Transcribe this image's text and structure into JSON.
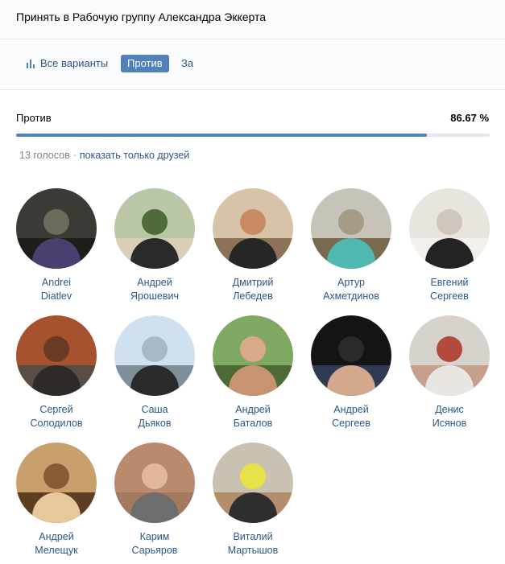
{
  "header": {
    "title": "Принять в Рабочую группу Александра Эккерта"
  },
  "tabs": {
    "all_label": "Все варианты",
    "against_label": "Против",
    "for_label": "За"
  },
  "result": {
    "label": "Против",
    "percent_text": "86.67 %",
    "percent_value": 86.67,
    "votes_text": "13 голосов",
    "separator": "·",
    "friends_link": "показать только друзей"
  },
  "colors": {
    "accent": "#5181b8",
    "link": "#2a5885",
    "muted": "#828282"
  },
  "voters": [
    {
      "first": "Andrei",
      "last": "Diatlev",
      "tones": [
        "#3b3a35",
        "#6e6a5c",
        "#4a3f6e",
        "#1f1d1a"
      ]
    },
    {
      "first": "Андрей",
      "last": "Ярошевич",
      "tones": [
        "#b9c7a6",
        "#4f6a3b",
        "#2a2a2a",
        "#d9cdb8"
      ]
    },
    {
      "first": "Дмитрий",
      "last": "Лебедев",
      "tones": [
        "#d7c4a8",
        "#c98a63",
        "#262626",
        "#8c7358"
      ]
    },
    {
      "first": "Артур",
      "last": "Ахметдинов",
      "tones": [
        "#c8c3b8",
        "#a69b86",
        "#4fb8b0",
        "#7a6a4d"
      ]
    },
    {
      "first": "Евгений",
      "last": "Сергеев",
      "tones": [
        "#e8e4de",
        "#cfc7bd",
        "#232323",
        "#f4f1ec"
      ]
    },
    {
      "first": "Сергей",
      "last": "Солодилов",
      "tones": [
        "#a6522e",
        "#6b3a22",
        "#2d2a27",
        "#5a4d44"
      ]
    },
    {
      "first": "Саша",
      "last": "Дьяков",
      "tones": [
        "#cfe0ef",
        "#a7b9c4",
        "#2b2b2b",
        "#7e8f9a"
      ]
    },
    {
      "first": "Андрей",
      "last": "Баталов",
      "tones": [
        "#7fa862",
        "#d9a98a",
        "#c89373",
        "#4c6a33"
      ]
    },
    {
      "first": "Андрей",
      "last": "Сергеев",
      "tones": [
        "#141414",
        "#2a2a2a",
        "#d4a88c",
        "#303a52"
      ]
    },
    {
      "first": "Денис",
      "last": "Исянов",
      "tones": [
        "#d8d2cc",
        "#b24a3e",
        "#e9e6e2",
        "#c4a08a"
      ]
    },
    {
      "first": "Андрей",
      "last": "Мелещук",
      "tones": [
        "#c9a06b",
        "#8a5a34",
        "#e6c89a",
        "#5e3e22"
      ]
    },
    {
      "first": "Карим",
      "last": "Сарьяров",
      "tones": [
        "#b98a6e",
        "#e0b79b",
        "#6d6d6d",
        "#a37a5e"
      ]
    },
    {
      "first": "Виталий",
      "last": "Мартышов",
      "tones": [
        "#c9c2b2",
        "#e6e24a",
        "#2e2e2e",
        "#b48d6a"
      ]
    }
  ]
}
